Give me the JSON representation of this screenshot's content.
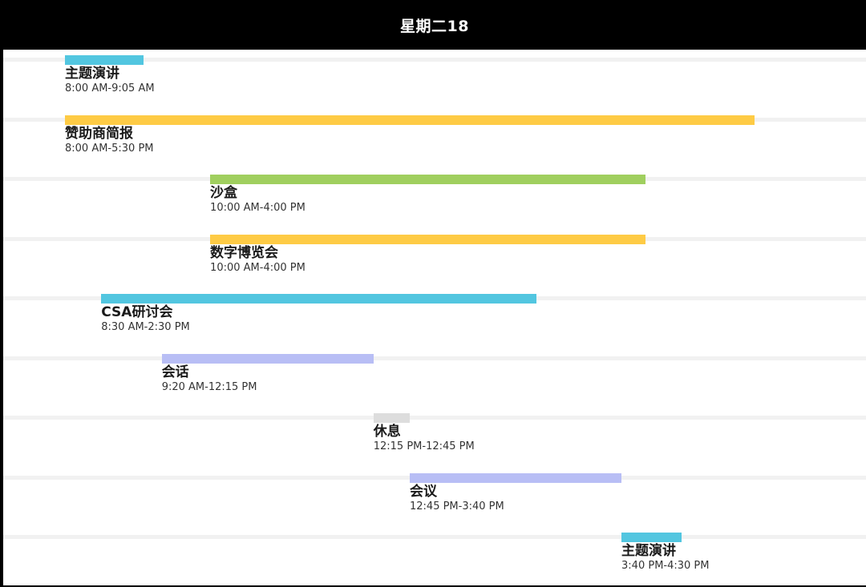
{
  "header": {
    "title": "星期二18"
  },
  "colors": {
    "cyan": "#52c6e0",
    "yellow": "#fecb45",
    "green": "#a0cf5f",
    "lavender": "#b8bef5",
    "gray": "#dddddd"
  },
  "events": [
    {
      "title": "主题演讲",
      "time": "8:00 AM-9:05 AM",
      "start": "8:00",
      "end": "9:05",
      "color": "#52c6e0"
    },
    {
      "title": "赞助商简报",
      "time": "8:00 AM-5:30 PM",
      "start": "8:00",
      "end": "17:30",
      "color": "#fecb45"
    },
    {
      "title": "沙盒",
      "time": "10:00 AM-4:00 PM",
      "start": "10:00",
      "end": "16:00",
      "color": "#a0cf5f"
    },
    {
      "title": "数字博览会",
      "time": "10:00 AM-4:00 PM",
      "start": "10:00",
      "end": "16:00",
      "color": "#fecb45"
    },
    {
      "title": "CSA研讨会",
      "time": "8:30 AM-2:30 PM",
      "start": "8:30",
      "end": "14:30",
      "color": "#52c6e0"
    },
    {
      "title": "会话",
      "time": "9:20 AM-12:15 PM",
      "start": "9:20",
      "end": "12:15",
      "color": "#b8bef5"
    },
    {
      "title": "休息",
      "time": "12:15 PM-12:45 PM",
      "start": "12:15",
      "end": "12:45",
      "color": "#dddddd"
    },
    {
      "title": "会议",
      "time": "12:45 PM-3:40 PM",
      "start": "12:45",
      "end": "15:40",
      "color": "#b8bef5"
    },
    {
      "title": "主题演讲",
      "time": "3:40 PM-4:30 PM",
      "start": "15:40",
      "end": "16:30",
      "color": "#52c6e0"
    }
  ]
}
